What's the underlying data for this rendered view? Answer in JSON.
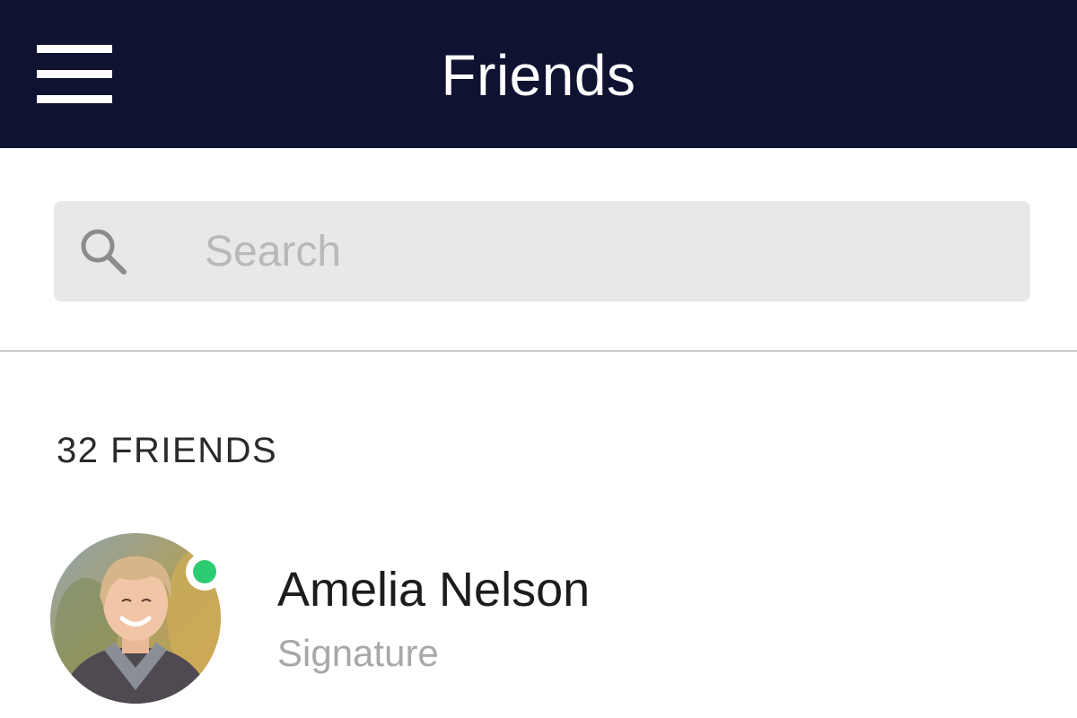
{
  "header": {
    "title": "Friends",
    "background_color": "#0f1231",
    "menu_icon": "hamburger-menu-icon"
  },
  "search": {
    "placeholder": "Search",
    "value": "",
    "icon": "search-icon"
  },
  "friends": {
    "count_label": "32 FRIENDS",
    "items": [
      {
        "name": "Amelia Nelson",
        "signature": "Signature",
        "online": true,
        "status_color": "#2ecc71",
        "avatar": "avatar-photo"
      }
    ]
  }
}
